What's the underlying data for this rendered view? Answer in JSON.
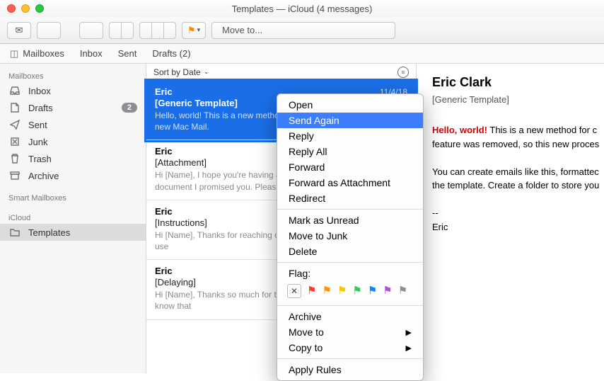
{
  "window": {
    "title": "Templates — iCloud (4 messages)"
  },
  "toolbar": {
    "moveto_label": "Move to..."
  },
  "favbar": {
    "mailboxes": "Mailboxes",
    "inbox": "Inbox",
    "sent": "Sent",
    "drafts": "Drafts (2)"
  },
  "sidebar": {
    "heads": {
      "mailboxes": "Mailboxes",
      "smart": "Smart Mailboxes",
      "icloud": "iCloud"
    },
    "items": {
      "inbox": "Inbox",
      "drafts": "Drafts",
      "drafts_badge": "2",
      "sent": "Sent",
      "junk": "Junk",
      "trash": "Trash",
      "archive": "Archive",
      "templates": "Templates"
    }
  },
  "sortbar": {
    "label": "Sort by Date"
  },
  "messages": [
    {
      "from": "Eric",
      "date": "11/4/18",
      "subject": "[Generic Template]",
      "preview": "Hello, world! This is a new method for creating templates in the new Mac Mail."
    },
    {
      "from": "Eric",
      "subject": "[Attachment]",
      "preview": "Hi [Name], I hope you're having a great day. Attached is the document I promised you. Please review."
    },
    {
      "from": "Eric",
      "subject": "[Instructions]",
      "preview": "Hi [Name], Thanks for reaching out about [procedure]! We prefer to use"
    },
    {
      "from": "Eric",
      "subject": "[Delaying]",
      "preview": "Hi [Name], Thanks so much for the email. I just wanted to let you know that"
    }
  ],
  "preview": {
    "from": "Eric Clark",
    "subject": "[Generic Template]",
    "hello": "Hello, world!",
    "line1_rest": " This is a new method for c",
    "line2": "feature was removed, so this new proces",
    "para2a": "You can create emails like this, formattec",
    "para2b": "the template. Create a folder to store you",
    "sig_dash": "--",
    "sig_name": "Eric"
  },
  "ctx": {
    "open": "Open",
    "send_again": "Send Again",
    "reply": "Reply",
    "reply_all": "Reply All",
    "forward": "Forward",
    "forward_att": "Forward as Attachment",
    "redirect": "Redirect",
    "mark_unread": "Mark as Unread",
    "move_junk": "Move to Junk",
    "delete": "Delete",
    "flag_label": "Flag:",
    "archive": "Archive",
    "move_to": "Move to",
    "copy_to": "Copy to",
    "apply_rules": "Apply Rules",
    "flag_colors": [
      "#ff3b30",
      "#ff9500",
      "#ffcc00",
      "#34c759",
      "#0a84ff",
      "#af52de",
      "#8e8e93"
    ]
  }
}
